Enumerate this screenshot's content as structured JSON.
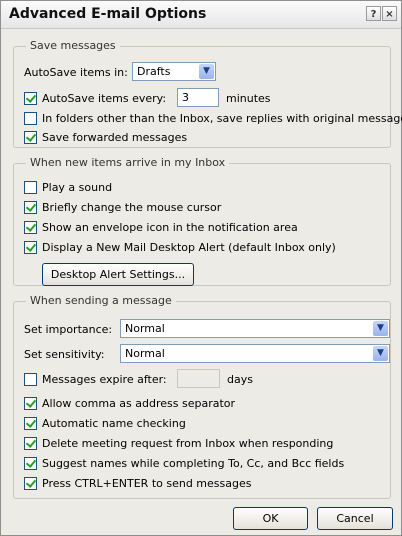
{
  "window": {
    "title": "Advanced E-mail Options",
    "help_label": "?",
    "close_label": "×"
  },
  "save_messages": {
    "legend": "Save messages",
    "autosave_in_label": "AutoSave items in:",
    "autosave_folder": "Drafts",
    "autosave_every_label": "AutoSave items every:",
    "autosave_every_value": "3",
    "minutes_label": "minutes",
    "autosave_every_checked": true,
    "replies_label": "In folders other than the Inbox, save replies with original message",
    "replies_checked": false,
    "forwarded_label": "Save forwarded messages",
    "forwarded_checked": true
  },
  "new_items": {
    "legend": "When new items arrive in my Inbox",
    "items": [
      {
        "label": "Play a sound",
        "checked": false
      },
      {
        "label": "Briefly change the mouse cursor",
        "checked": true
      },
      {
        "label": "Show an envelope icon in the notification area",
        "checked": true
      },
      {
        "label": "Display a New Mail Desktop Alert (default Inbox only)",
        "checked": true
      }
    ],
    "alert_settings_button": "Desktop Alert Settings..."
  },
  "sending": {
    "legend": "When sending a message",
    "importance_label": "Set importance:",
    "importance_value": "Normal",
    "sensitivity_label": "Set sensitivity:",
    "sensitivity_value": "Normal",
    "expire_label": "Messages expire after:",
    "expire_checked": false,
    "expire_value": "",
    "days_label": "days",
    "items": [
      {
        "label": "Allow comma as address separator",
        "checked": true
      },
      {
        "label": "Automatic name checking",
        "checked": true
      },
      {
        "label": "Delete meeting request from Inbox when responding",
        "checked": true
      },
      {
        "label": "Suggest names while completing To, Cc, and Bcc fields",
        "checked": true
      },
      {
        "label": "Press CTRL+ENTER to send messages",
        "checked": true
      }
    ]
  },
  "buttons": {
    "ok": "OK",
    "cancel": "Cancel"
  },
  "icons": {
    "dropdown": "chevron-down-icon",
    "check": "checkmark-icon"
  }
}
